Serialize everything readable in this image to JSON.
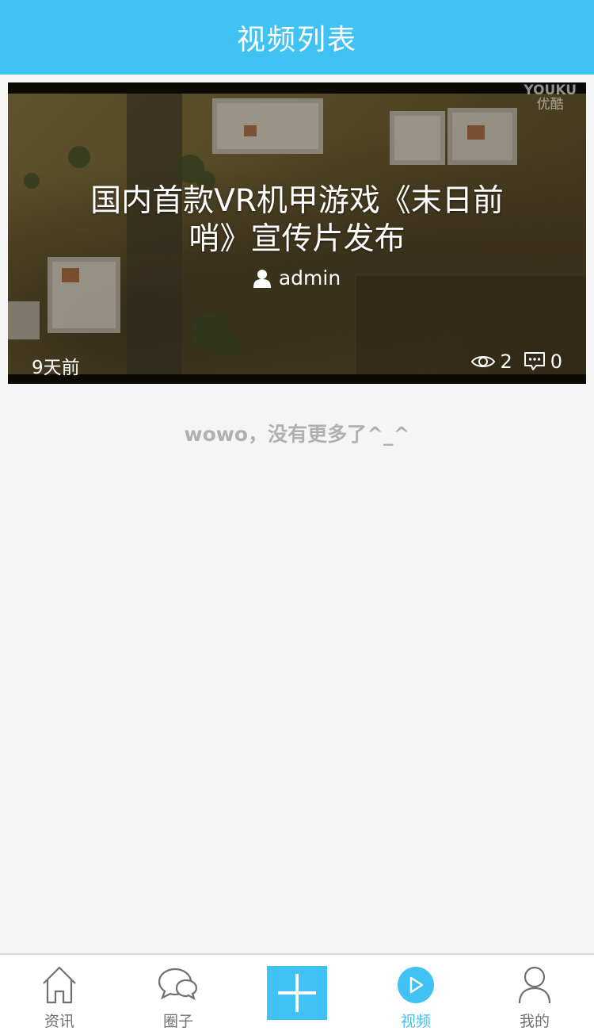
{
  "header": {
    "title": "视频列表"
  },
  "video": {
    "watermark_en": "YOUKU",
    "watermark_cn": "优酷",
    "title": "国内首款VR机甲游戏《末日前哨》宣传片发布",
    "author": "admin",
    "time": "9天前",
    "views": "2",
    "comments": "0"
  },
  "list": {
    "end_text": "wowo，没有更多了^_^"
  },
  "tabbar": {
    "items": [
      {
        "label": "资讯",
        "icon": "home-icon"
      },
      {
        "label": "圈子",
        "icon": "chat-bubbles-icon"
      },
      {
        "label": "",
        "icon": "plus-icon"
      },
      {
        "label": "视频",
        "icon": "play-icon"
      },
      {
        "label": "我的",
        "icon": "user-icon"
      }
    ],
    "active_index": 3
  },
  "colors": {
    "accent": "#41c2f5",
    "tab_text": "#707070",
    "background": "#f5f5f5"
  }
}
